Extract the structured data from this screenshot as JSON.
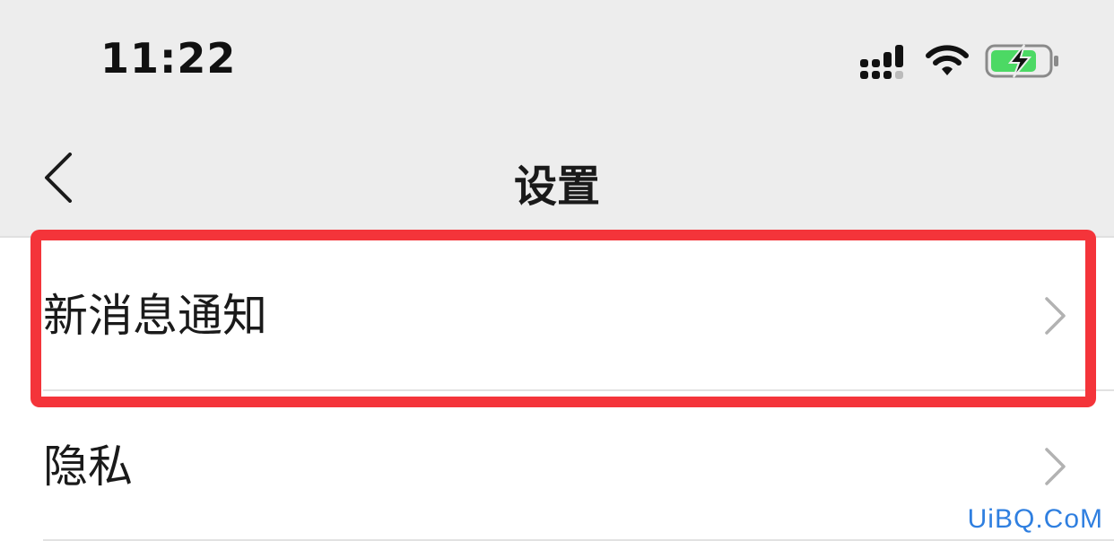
{
  "status_bar": {
    "time": "11:22",
    "icons": [
      "signal-icon",
      "wifi-icon",
      "battery-charging-icon"
    ],
    "battery_color": "#4cd964"
  },
  "nav": {
    "title": "设置",
    "back_icon": "chevron-left-icon"
  },
  "settings": {
    "items": [
      {
        "label": "新消息通知",
        "icon": "chevron-right-icon",
        "highlighted": true
      },
      {
        "label": "隐私",
        "icon": "chevron-right-icon",
        "highlighted": false
      }
    ]
  },
  "highlight_color": "#f4343a",
  "watermark": "UiBQ.CoM"
}
